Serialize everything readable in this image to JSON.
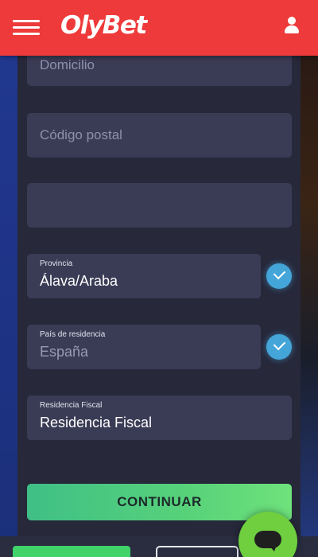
{
  "header": {
    "brand": "OlyBet",
    "menu_icon": "hamburger-menu-icon",
    "user_icon": "user-icon",
    "background_color": "#ee3a3a"
  },
  "form": {
    "domicilio": {
      "placeholder": "Domicilio"
    },
    "codigo_postal": {
      "placeholder": "Código postal"
    },
    "empty_field": {
      "placeholder": ""
    },
    "provincia": {
      "label": "Provincia",
      "value": "Álava/Araba",
      "validated": true
    },
    "pais": {
      "label": "País de residencia",
      "value": "España",
      "validated": true
    },
    "residencia_fiscal": {
      "label": "Residencia Fiscal",
      "value": "Residencia Fiscal"
    }
  },
  "actions": {
    "continue_label": "CONTINUAR",
    "continue_color": "#57d27a"
  },
  "chat": {
    "icon": "chat-bubble-icon",
    "color": "#6fcf3f"
  },
  "check_color": "#44a5d8"
}
